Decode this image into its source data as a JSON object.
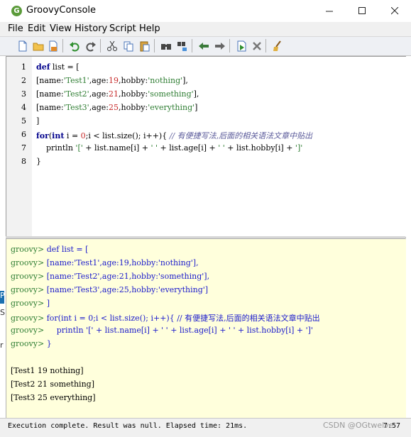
{
  "window": {
    "title": "GroovyConsole",
    "icon": "groovy-logo-icon"
  },
  "menu": [
    "File",
    "Edit",
    "View",
    "History",
    "Script",
    "Help"
  ],
  "toolbar": {
    "buttons": [
      "new-file-icon",
      "open-folder-icon",
      "save-icon",
      "undo-icon",
      "redo-icon",
      "cut-icon",
      "copy-icon",
      "paste-icon",
      "find-icon",
      "replace-icon",
      "previous-history-icon",
      "next-history-icon",
      "run-script-icon",
      "interrupt-icon",
      "clear-output-icon"
    ]
  },
  "editor": {
    "line_numbers": [
      "1",
      "2",
      "3",
      "4",
      "5",
      "6",
      "7",
      "8"
    ],
    "lines": [
      [
        {
          "t": "def",
          "c": "kw"
        },
        {
          "t": " list = [",
          "c": ""
        }
      ],
      [
        {
          "t": "[name:",
          "c": ""
        },
        {
          "t": "'Test1'",
          "c": "str"
        },
        {
          "t": ",age:",
          "c": ""
        },
        {
          "t": "19",
          "c": "num"
        },
        {
          "t": ",hobby:",
          "c": ""
        },
        {
          "t": "'nothing'",
          "c": "str"
        },
        {
          "t": "],",
          "c": ""
        }
      ],
      [
        {
          "t": "[name:",
          "c": ""
        },
        {
          "t": "'Test2'",
          "c": "str"
        },
        {
          "t": ",age:",
          "c": ""
        },
        {
          "t": "21",
          "c": "num"
        },
        {
          "t": ",hobby:",
          "c": ""
        },
        {
          "t": "'something'",
          "c": "str"
        },
        {
          "t": "],",
          "c": ""
        }
      ],
      [
        {
          "t": "[name:",
          "c": ""
        },
        {
          "t": "'Test3'",
          "c": "str"
        },
        {
          "t": ",age:",
          "c": ""
        },
        {
          "t": "25",
          "c": "num"
        },
        {
          "t": ",hobby:",
          "c": ""
        },
        {
          "t": "'everything'",
          "c": "str"
        },
        {
          "t": "]",
          "c": ""
        }
      ],
      [
        {
          "t": "]",
          "c": ""
        }
      ],
      [
        {
          "t": "for",
          "c": "kw"
        },
        {
          "t": "(",
          "c": ""
        },
        {
          "t": "int",
          "c": "kw"
        },
        {
          "t": " i = ",
          "c": ""
        },
        {
          "t": "0",
          "c": "num"
        },
        {
          "t": ";i < list.size(); i++){ ",
          "c": ""
        },
        {
          "t": "// 有便捷写法,后面的相关语法文章中贴出",
          "c": "cmt"
        }
      ],
      [
        {
          "t": "    println ",
          "c": ""
        },
        {
          "t": "'['",
          "c": "str"
        },
        {
          "t": " + list.name[i] + ",
          "c": ""
        },
        {
          "t": "' '",
          "c": "str"
        },
        {
          "t": " + list.age[i] + ",
          "c": ""
        },
        {
          "t": "' '",
          "c": "str"
        },
        {
          "t": " + list.hobby[i] + ",
          "c": ""
        },
        {
          "t": "']'",
          "c": "str"
        }
      ],
      [
        {
          "t": "}",
          "c": ""
        }
      ]
    ]
  },
  "output": {
    "prompt": "groovy>",
    "echo_lines": [
      "def list = [",
      "[name:'Test1',age:19,hobby:'nothing'],",
      "[name:'Test2',age:21,hobby:'something'],",
      "[name:'Test3',age:25,hobby:'everything']",
      "]",
      "for(int i = 0;i < list.size(); i++){ // 有便捷写法,后面的相关语法文章中贴出",
      "    println '[' + list.name[i] + ' ' + list.age[i] + ' ' + list.hobby[i] + ']'",
      "}"
    ],
    "results": [
      "[Test1 19 nothing]",
      "[Test2 21 something]",
      "[Test3 25 everything]"
    ]
  },
  "status": {
    "message": "Execution complete. Result was null. Elapsed time: 21ms.",
    "position": "7:57"
  },
  "watermark": "CSDN @OGtwelve",
  "background_fragments": [
    "P",
    "S",
    "r"
  ]
}
